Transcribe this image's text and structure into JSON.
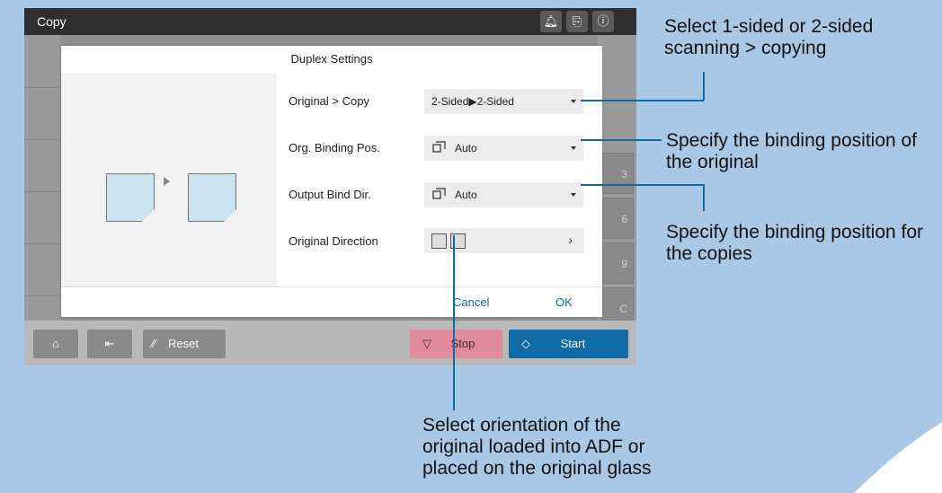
{
  "window": {
    "title": "Copy"
  },
  "dialog": {
    "title": "Duplex Settings",
    "rows": [
      {
        "label": "Original > Copy",
        "value": "2-Sided▶2-Sided"
      },
      {
        "label": "Org. Binding Pos.",
        "value": "Auto"
      },
      {
        "label": "Output Bind Dir.",
        "value": "Auto"
      },
      {
        "label": "Original Direction",
        "value": ""
      }
    ],
    "cancel_label": "Cancel",
    "ok_label": "OK"
  },
  "background_right_keys": [
    "3",
    "6",
    "9",
    "C"
  ],
  "bottombar": {
    "reset_label": "Reset",
    "stop_label": "Stop",
    "start_label": "Start"
  },
  "annotations": {
    "scan_mode": "Select 1-sided or 2-sided scanning > copying",
    "original_binding": "Specify the binding position of the original",
    "copy_binding": "Specify the binding position for the copies",
    "orientation": "Select orientation of the original loaded into ADF or placed on the original glass"
  },
  "colors": {
    "accent": "#0f6aa8",
    "stop": "#e08a9c",
    "page_bg": "#a9c8e6"
  },
  "icons": [
    "bell-icon",
    "job-status-icon",
    "info-icon",
    "home-icon",
    "login-icon",
    "reset-icon",
    "stop-icon",
    "start-icon",
    "binding-icon"
  ]
}
